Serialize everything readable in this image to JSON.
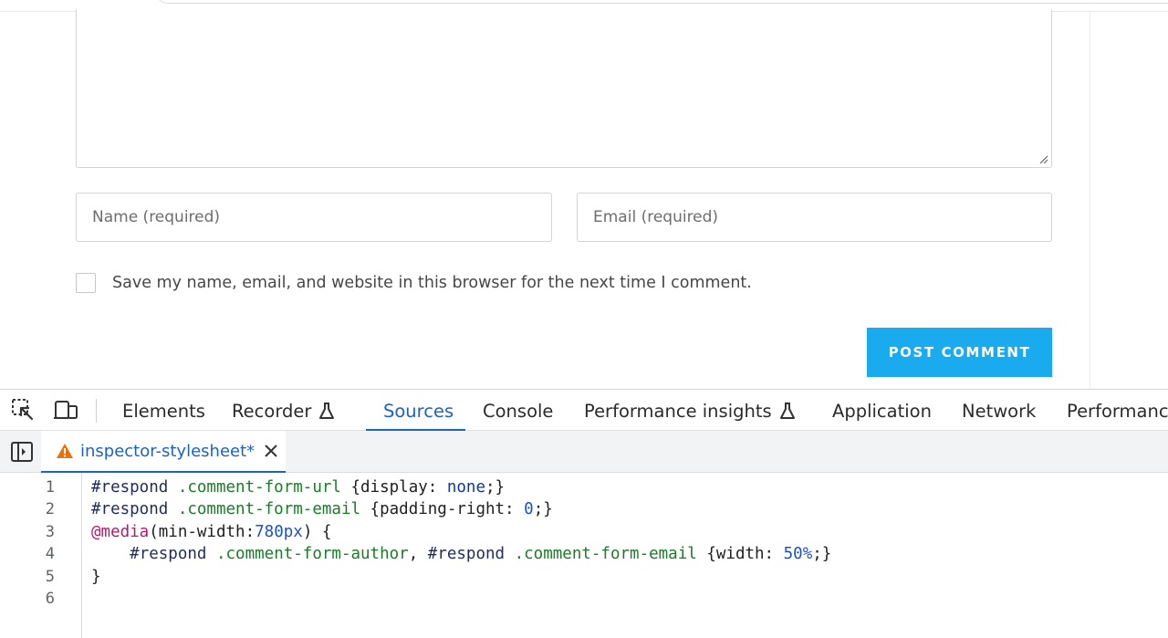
{
  "form": {
    "name_placeholder": "Name (required)",
    "email_placeholder": "Email (required)",
    "save_label": "Save my name, email, and website in this browser for the next time I comment.",
    "post_button": "POST COMMENT"
  },
  "devtools": {
    "tabs": [
      {
        "label": "Elements"
      },
      {
        "label": "Recorder"
      },
      {
        "label": "Sources",
        "active": true
      },
      {
        "label": "Console"
      },
      {
        "label": "Performance insights"
      },
      {
        "label": "Application"
      },
      {
        "label": "Network"
      },
      {
        "label": "Performance"
      }
    ],
    "file": {
      "name": "inspector-stylesheet*"
    },
    "line_numbers": [
      "1",
      "2",
      "3",
      "4",
      "5",
      "6"
    ],
    "code": [
      [
        [
          "#respond ",
          "sel"
        ],
        [
          ".comment-form-url",
          "cls"
        ],
        [
          " {display: ",
          "txt"
        ],
        [
          "none",
          "kw"
        ],
        [
          ";}",
          "txt"
        ]
      ],
      [
        [
          "#respond ",
          "sel"
        ],
        [
          ".comment-form-email",
          "cls"
        ],
        [
          " {padding-right: ",
          "txt"
        ],
        [
          "0",
          "num"
        ],
        [
          ";}",
          "txt"
        ]
      ],
      [
        [
          "@media",
          "at"
        ],
        [
          "(min-width:",
          "txt"
        ],
        [
          "780px",
          "num"
        ],
        [
          ") {",
          "txt"
        ]
      ],
      [
        [
          "    ",
          "txt"
        ],
        [
          "#respond ",
          "sel"
        ],
        [
          ".comment-form-author",
          "cls"
        ],
        [
          ", ",
          "txt"
        ],
        [
          "#respond ",
          "sel"
        ],
        [
          ".comment-form-email",
          "cls"
        ],
        [
          " {width: ",
          "txt"
        ],
        [
          "50%",
          "num"
        ],
        [
          ";}",
          "txt"
        ]
      ],
      [
        [
          "}",
          "txt"
        ]
      ],
      []
    ]
  },
  "colors": {
    "accent": "#1aaaee",
    "devtools_blue": "#1a62c9",
    "warning": "#e8710a"
  },
  "icons": [
    "select-element-icon",
    "device-toolbar-icon",
    "flask-icon",
    "show-navigator-icon",
    "warning-icon",
    "close-icon",
    "resize-grip-icon"
  ]
}
